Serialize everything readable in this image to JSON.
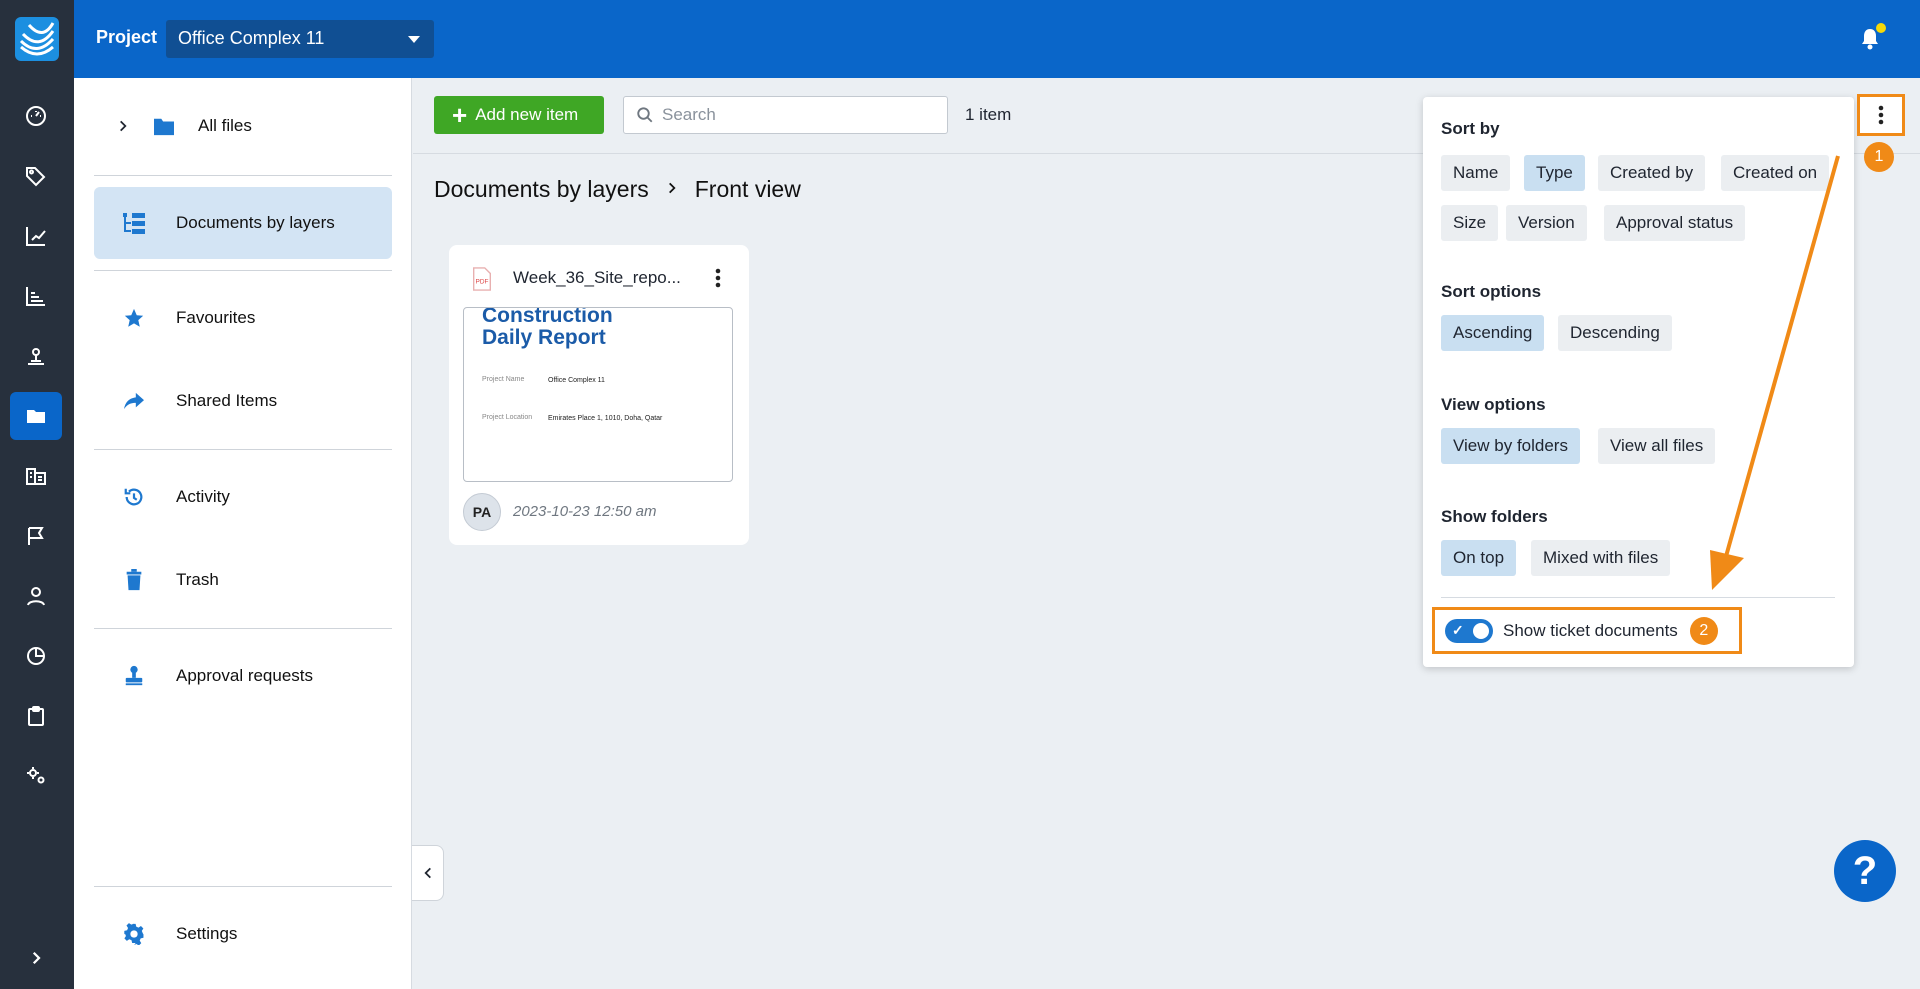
{
  "app": {
    "accent": "#0a66c9",
    "rail_bg": "#27303d",
    "annotation_color": "#f08a17"
  },
  "topbar": {
    "project_label": "Project",
    "project_name": "Office Complex 11"
  },
  "rail": {
    "icons": [
      "dashboard-icon",
      "tag-icon",
      "edit-chart-icon",
      "line-chart-icon",
      "location-pin-icon",
      "folder-icon",
      "buildings-icon",
      "flag-icon",
      "user-icon",
      "pie-chart-icon",
      "clipboard-icon",
      "settings-gears-icon"
    ],
    "active_index": 5
  },
  "sidebar": {
    "all_files": "All files",
    "documents_by_layers": "Documents by layers",
    "favourites": "Favourites",
    "shared_items": "Shared Items",
    "activity": "Activity",
    "trash": "Trash",
    "approval_requests": "Approval requests",
    "settings": "Settings"
  },
  "toolbar": {
    "add_label": "Add new item",
    "search_placeholder": "Search",
    "item_count": "1 item"
  },
  "breadcrumb": {
    "root": "Documents by layers",
    "current": "Front view"
  },
  "card": {
    "file_name": "Week_36_Site_repo...",
    "thumb_title_1": "Construction",
    "thumb_title_2": "Daily Report",
    "thumb_project_name_label": "Project Name",
    "thumb_project_name_value": "Office Complex 11",
    "thumb_location_label": "Project Location",
    "thumb_location_value": "Emirates Place 1, 1010, Doha, Qatar",
    "avatar": "PA",
    "date": "2023-10-23 12:50 am"
  },
  "panel": {
    "sort_by": "Sort by",
    "sort_by_options": [
      "Name",
      "Type",
      "Created by",
      "Created on",
      "Size",
      "Version",
      "Approval status"
    ],
    "sort_by_selected": "Type",
    "sort_options": "Sort options",
    "sort_options_values": [
      "Ascending",
      "Descending"
    ],
    "sort_options_selected": "Ascending",
    "view_options": "View options",
    "view_options_values": [
      "View by folders",
      "View all files"
    ],
    "view_options_selected": "View by folders",
    "show_folders": "Show folders",
    "show_folders_values": [
      "On top",
      "Mixed with files"
    ],
    "show_folders_selected": "On top",
    "toggle_label": "Show ticket documents",
    "toggle_on": true
  },
  "annotations": {
    "badge1": "1",
    "badge2": "2"
  },
  "help": {
    "label": "?"
  }
}
